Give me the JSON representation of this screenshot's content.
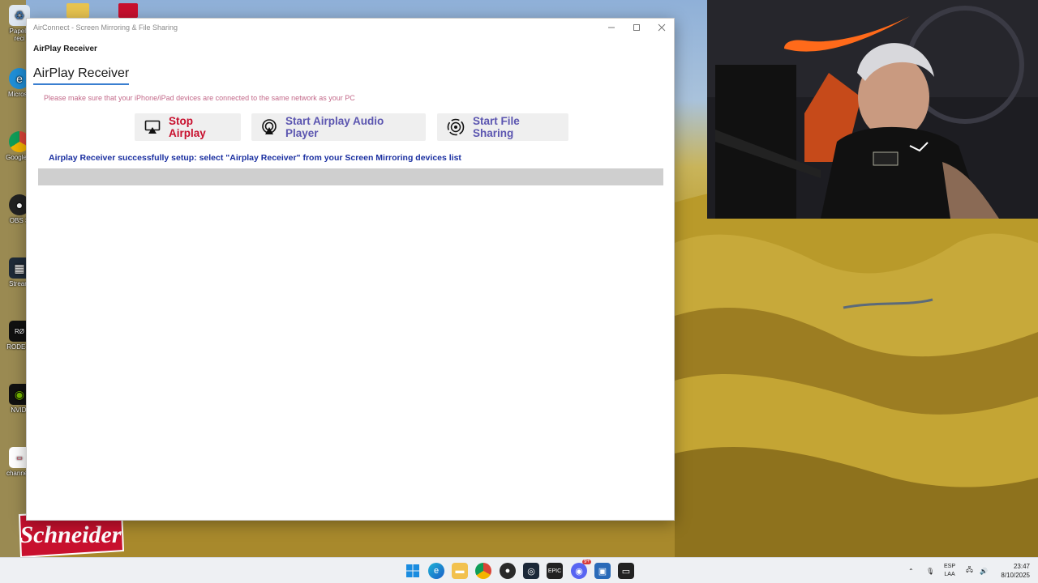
{
  "window": {
    "title": "AirConnect - Screen Mirroring & File Sharing",
    "app_header": "AirPlay Receiver",
    "page_title": "AirPlay Receiver",
    "notice": "Please make sure that your iPhone/iPad devices are connected to the same network as your PC",
    "buttons": {
      "stop": {
        "label": "Stop Airplay",
        "icon": "airplay-screen-icon"
      },
      "audio": {
        "label": "Start Airplay Audio Player",
        "icon": "airplay-audio-icon"
      },
      "share": {
        "label": "Start File Sharing",
        "icon": "file-sharing-icon"
      }
    },
    "status_message": "Airplay Receiver successfully setup: select \"Airplay Receiver\" from your Screen Mirroring devices list",
    "progress_value": 0,
    "colors": {
      "stop": "#c8102e",
      "action": "#5b55b0",
      "status": "#1a2fa0",
      "notice": "#c36a8a",
      "accent": "#3a7fd0"
    }
  },
  "desktop": {
    "icons": [
      {
        "label": "Papelera de reciclaje",
        "short": "Papele reci"
      },
      {
        "label": "Microsoft Edge",
        "short": "Microso"
      },
      {
        "label": "Google Chrome",
        "short": "Google C"
      },
      {
        "label": "OBS Studio",
        "short": "OBS S"
      },
      {
        "label": "Streamlabs",
        "short": "Stream"
      },
      {
        "label": "RODECaster",
        "short": "RODEca"
      },
      {
        "label": "NVIDIA",
        "short": "NVIDI"
      },
      {
        "label": "channels",
        "short": "channels"
      }
    ],
    "brand_logo": "Schneider"
  },
  "taskbar": {
    "apps": [
      "start-icon",
      "edge-icon",
      "file-explorer-icon",
      "chrome-icon",
      "obs-icon",
      "steam-icon",
      "epic-games-icon",
      "discord-icon",
      "store-icon",
      "airconnect-icon"
    ],
    "discord_badge": "9+",
    "language": "ESP",
    "language_sub": "LAA",
    "time": "23:47",
    "date": "8/10/2025"
  }
}
